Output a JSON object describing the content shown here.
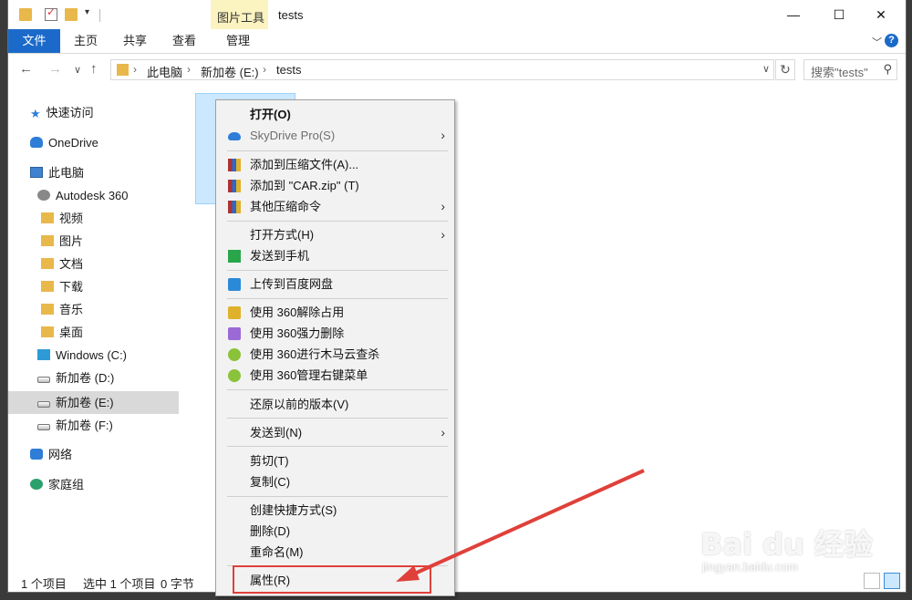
{
  "titlebar": {
    "contextual_group": "图片工具",
    "title": "tests",
    "minimize": "—",
    "maximize": "☐",
    "close": "✕"
  },
  "ribbon": {
    "tabs": [
      "文件",
      "主页",
      "共享",
      "查看",
      "管理"
    ],
    "chevron": "﹀",
    "help": "?"
  },
  "address": {
    "back": "←",
    "forward": "→",
    "recent": "∨",
    "up": "↑",
    "crumbs": [
      "此电脑",
      "新加卷 (E:)",
      "tests"
    ],
    "sep": "›",
    "search_placeholder": "搜索\"tests\"",
    "refresh": "↻"
  },
  "navpane": {
    "items": [
      {
        "label": "快速访问",
        "icon": "star-icon"
      },
      {
        "label": "OneDrive",
        "icon": "cloud-icon"
      },
      {
        "label": "此电脑",
        "icon": "computer-icon"
      },
      {
        "label": "Autodesk 360",
        "icon": "autodesk-icon"
      },
      {
        "label": "视频",
        "icon": "video-folder-icon"
      },
      {
        "label": "图片",
        "icon": "pictures-folder-icon"
      },
      {
        "label": "文档",
        "icon": "documents-folder-icon"
      },
      {
        "label": "下载",
        "icon": "downloads-folder-icon"
      },
      {
        "label": "音乐",
        "icon": "music-folder-icon"
      },
      {
        "label": "桌面",
        "icon": "desktop-folder-icon"
      },
      {
        "label": "Windows (C:)",
        "icon": "windows-drive-icon"
      },
      {
        "label": "新加卷 (D:)",
        "icon": "drive-icon"
      },
      {
        "label": "新加卷 (E:)",
        "icon": "drive-icon",
        "selected": true
      },
      {
        "label": "新加卷 (F:)",
        "icon": "drive-icon"
      },
      {
        "label": "网络",
        "icon": "network-icon"
      },
      {
        "label": "家庭组",
        "icon": "homegroup-icon"
      }
    ]
  },
  "context_menu": {
    "items": [
      {
        "label": "打开(O)",
        "bold": true
      },
      {
        "label": "SkyDrive Pro(S)",
        "disabled": true,
        "submenu": true,
        "icon": "skydrive-icon"
      },
      {
        "label": "添加到压缩文件(A)...",
        "icon": "winrar-icon"
      },
      {
        "label": "添加到 \"CAR.zip\" (T)",
        "icon": "winrar-icon"
      },
      {
        "label": "其他压缩命令",
        "submenu": true,
        "icon": "winrar-icon"
      },
      {
        "label": "打开方式(H)",
        "submenu": true
      },
      {
        "label": "发送到手机",
        "icon": "send-to-phone-icon"
      },
      {
        "label": "上传到百度网盘",
        "icon": "baidu-netdisk-icon"
      },
      {
        "label": "使用 360解除占用",
        "icon": "360-unlock-icon"
      },
      {
        "label": "使用 360强力删除",
        "icon": "360-delete-icon"
      },
      {
        "label": "使用 360进行木马云查杀",
        "icon": "360-scan-icon"
      },
      {
        "label": "使用 360管理右键菜单",
        "icon": "360-menu-icon"
      },
      {
        "label": "还原以前的版本(V)"
      },
      {
        "label": "发送到(N)",
        "submenu": true
      },
      {
        "label": "剪切(T)"
      },
      {
        "label": "复制(C)"
      },
      {
        "label": "创建快捷方式(S)"
      },
      {
        "label": "删除(D)"
      },
      {
        "label": "重命名(M)"
      },
      {
        "label": "属性(R)",
        "highlighted": true
      }
    ],
    "submenu_arrow": "›"
  },
  "status": {
    "item_count": "1 个项目",
    "selected": "选中 1 个项目",
    "size": "0 字节"
  },
  "watermark": {
    "text": "Bai du 经验",
    "sub": "jingyan.baidu.com"
  },
  "colors": {
    "accent": "#1b6ac9",
    "highlight_red": "#e0403a",
    "selection": "#cce8ff"
  }
}
